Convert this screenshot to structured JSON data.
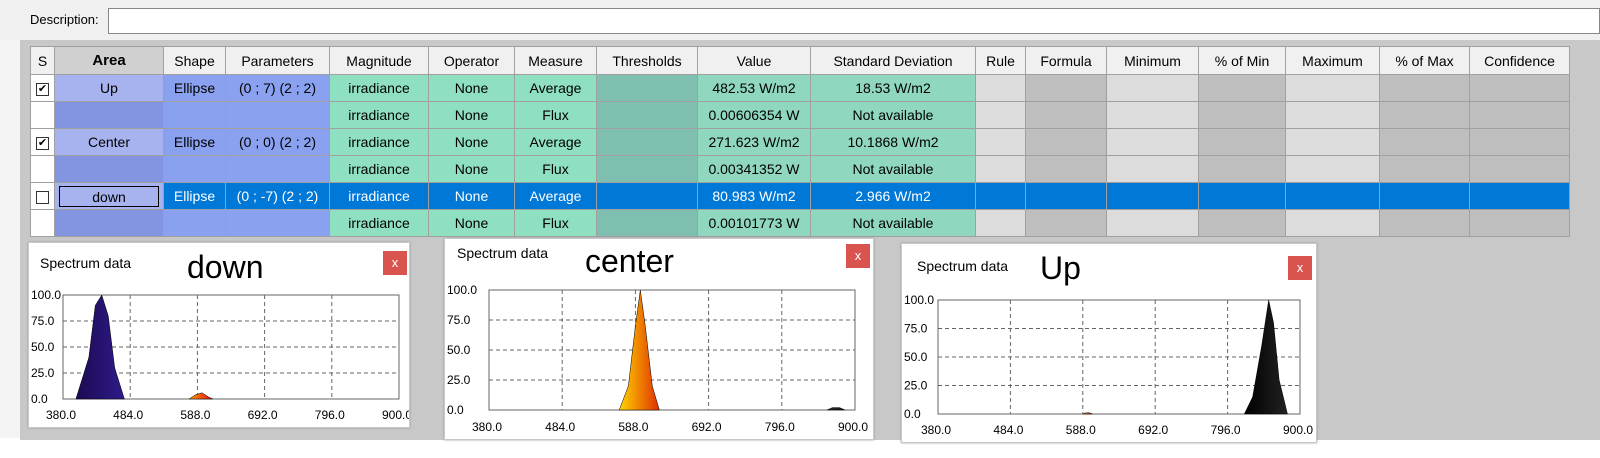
{
  "description": {
    "label": "Description:",
    "value": ""
  },
  "grid": {
    "headers": [
      "S",
      "Area",
      "Shape",
      "Parameters",
      "Magnitude",
      "Operator",
      "Measure",
      "Thresholds",
      "Value",
      "Standard Deviation",
      "Rule",
      "Formula",
      "Minimum",
      "% of Min",
      "Maximum",
      "% of Max",
      "Confidence"
    ],
    "rows": [
      {
        "checked": true,
        "area": "Up",
        "shape": "Ellipse",
        "params": "(0 ; 7) (2 ; 2)",
        "magnitude": "irradiance",
        "operator": "None",
        "measure": "Average",
        "value": "482.53 W/m2",
        "std": "18.53 W/m2"
      },
      {
        "checked": null,
        "area": "",
        "shape": "",
        "params": "",
        "magnitude": "irradiance",
        "operator": "None",
        "measure": "Flux",
        "value": "0.00606354 W",
        "std": "Not available"
      },
      {
        "checked": true,
        "area": "Center",
        "shape": "Ellipse",
        "params": "(0 ; 0) (2 ; 2)",
        "magnitude": "irradiance",
        "operator": "None",
        "measure": "Average",
        "value": "271.623 W/m2",
        "std": "10.1868 W/m2"
      },
      {
        "checked": null,
        "area": "",
        "shape": "",
        "params": "",
        "magnitude": "irradiance",
        "operator": "None",
        "measure": "Flux",
        "value": "0.00341352 W",
        "std": "Not available"
      },
      {
        "checked": true,
        "area": "down",
        "shape": "Ellipse",
        "params": "(0 ; -7) (2 ; 2)",
        "magnitude": "irradiance",
        "operator": "None",
        "measure": "Average",
        "value": "80.983 W/m2",
        "std": "2.966 W/m2",
        "selected": true
      },
      {
        "checked": null,
        "area": "",
        "shape": "",
        "params": "",
        "magnitude": "irradiance",
        "operator": "None",
        "measure": "Flux",
        "value": "0.00101773 W",
        "std": "Not available"
      }
    ]
  },
  "panels": [
    {
      "title": "Spectrum data",
      "label": "down",
      "close": "x",
      "yticks": [
        "100.0",
        "75.0",
        "50.0",
        "25.0",
        "0.0"
      ],
      "xticks": [
        "380.0",
        "484.0",
        "588.0",
        "692.0",
        "796.0",
        "900.0"
      ]
    },
    {
      "title": "Spectrum data",
      "label": "center",
      "close": "x",
      "yticks": [
        "100.0",
        "75.0",
        "50.0",
        "25.0",
        "0.0"
      ],
      "xticks": [
        "380.0",
        "484.0",
        "588.0",
        "692.0",
        "796.0",
        "900.0"
      ]
    },
    {
      "title": "Spectrum data",
      "label": "Up",
      "close": "x",
      "yticks": [
        "100.0",
        "75.0",
        "50.0",
        "25.0",
        "0.0"
      ],
      "xticks": [
        "380.0",
        "484.0",
        "588.0",
        "692.0",
        "796.0",
        "900.0"
      ]
    }
  ],
  "chart_data": [
    {
      "type": "area",
      "title": "Spectrum data",
      "xlim": [
        380,
        900
      ],
      "ylim": [
        0,
        100
      ],
      "series": [
        {
          "values": [
            [
              400,
              0
            ],
            [
              420,
              40
            ],
            [
              430,
              90
            ],
            [
              440,
              100
            ],
            [
              450,
              80
            ],
            [
              460,
              30
            ],
            [
              475,
              0
            ]
          ]
        },
        {
          "values": [
            [
              575,
              0
            ],
            [
              585,
              4
            ],
            [
              595,
              6
            ],
            [
              605,
              2
            ],
            [
              612,
              0
            ]
          ]
        }
      ]
    },
    {
      "type": "area",
      "title": "Spectrum data",
      "xlim": [
        380,
        900
      ],
      "ylim": [
        0,
        100
      ],
      "series": [
        {
          "values": [
            [
              565,
              0
            ],
            [
              578,
              20
            ],
            [
              588,
              70
            ],
            [
              595,
              100
            ],
            [
              602,
              70
            ],
            [
              612,
              20
            ],
            [
              622,
              0
            ]
          ]
        },
        {
          "values": [
            [
              860,
              0
            ],
            [
              868,
              2
            ],
            [
              878,
              2
            ],
            [
              886,
              0
            ]
          ]
        }
      ]
    },
    {
      "type": "area",
      "title": "Spectrum data",
      "xlim": [
        380,
        900
      ],
      "ylim": [
        0,
        100
      ],
      "series": [
        {
          "values": [
            [
              820,
              0
            ],
            [
              832,
              15
            ],
            [
              845,
              60
            ],
            [
              855,
              100
            ],
            [
              862,
              80
            ],
            [
              870,
              30
            ],
            [
              882,
              0
            ]
          ]
        },
        {
          "values": [
            [
              588,
              0
            ],
            [
              592,
              1
            ],
            [
              598,
              1
            ],
            [
              602,
              0
            ]
          ]
        }
      ]
    }
  ],
  "colors": {
    "selected": "#0078d7",
    "close": "#d9534f"
  }
}
